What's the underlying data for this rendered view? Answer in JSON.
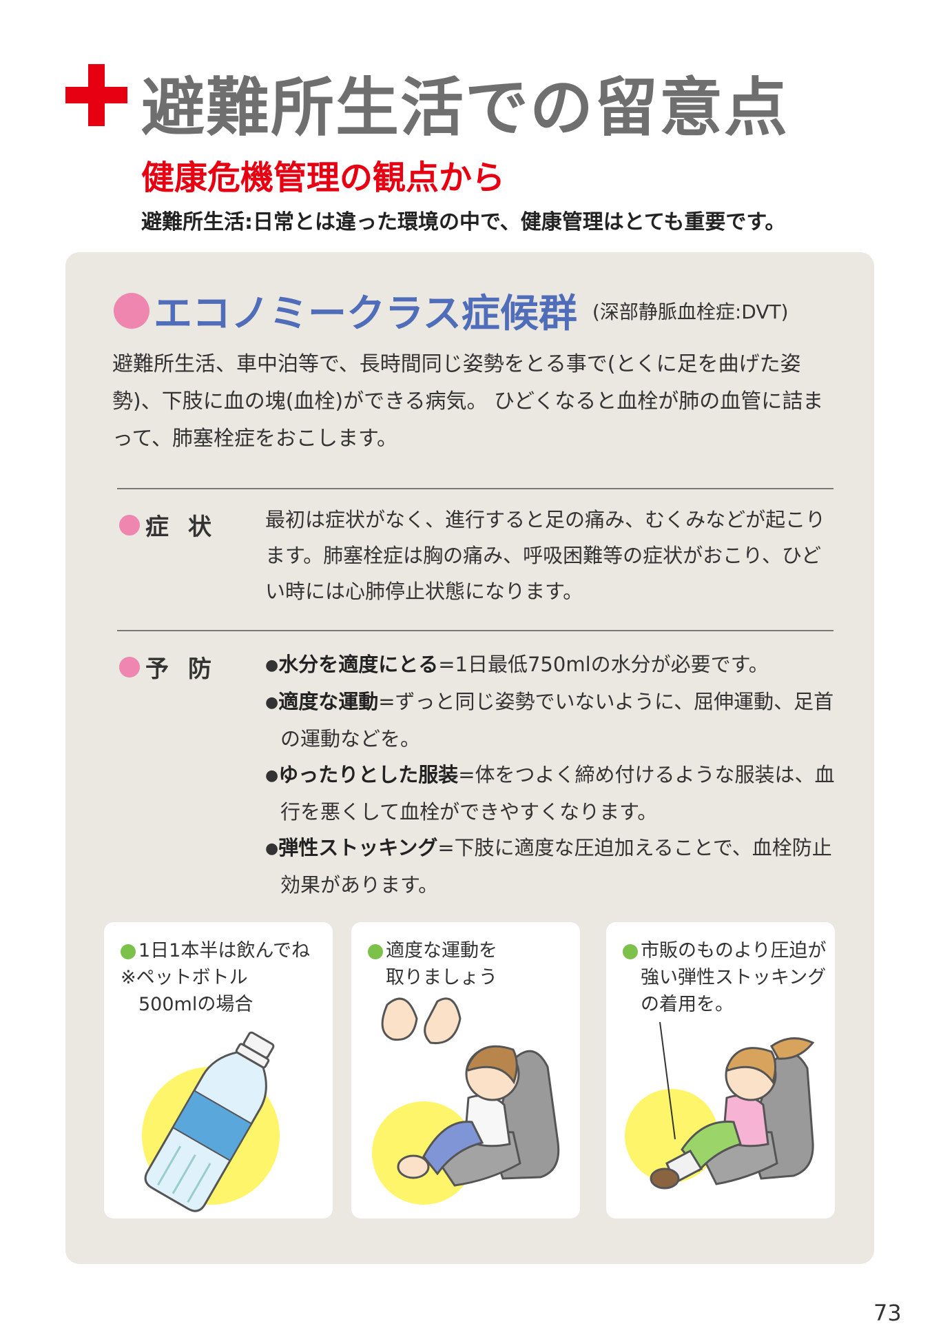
{
  "colors": {
    "accent_red": "#e60012",
    "title_gray": "#6f6f6f",
    "section_blue": "#4f6db8",
    "pink_bullet": "#ee86b0",
    "green_bullet": "#7bc14a",
    "panel_bg": "#ebe7e1",
    "illustration_yellow": "#fff56b"
  },
  "header": {
    "title": "避難所生活での留意点",
    "subtitle": "健康危機管理の観点から",
    "lead": "避難所生活:日常とは違った環境の中で、健康管理はとても重要です。"
  },
  "section": {
    "title": "エコノミークラス症候群",
    "subtitle": "(深部静脈血栓症:DVT)",
    "intro": "避難所生活、車中泊等で、長時間同じ姿勢をとる事で(とくに足を曲げた姿勢)、下肢に血の塊(血栓)ができる病気。 ひどくなると血栓が肺の血管に詰まって、肺塞栓症をおこします。"
  },
  "symptoms": {
    "label": "症状",
    "text": "最初は症状がなく、進行すると足の痛み、むくみなどが起こります。肺塞栓症は胸の痛み、呼吸困難等の症状がおこり、ひどい時には心肺停止状態になります。"
  },
  "prevention": {
    "label": "予防",
    "bullet": "●",
    "items": [
      {
        "term": "水分を適度にとる",
        "desc": "=1日最低750mlの水分が必要です。"
      },
      {
        "term": "適度な運動",
        "desc": "=ずっと同じ姿勢でいないように、屈伸運動、足首の運動などを。"
      },
      {
        "term": "ゆったりとした服装",
        "desc": "=体をつよく締め付けるような服装は、血行を悪くして血栓ができやすくなります。"
      },
      {
        "term": "弾性ストッキング",
        "desc": "=下肢に適度な圧迫加えることで、血栓防止効果があります。"
      }
    ]
  },
  "cards": [
    {
      "line1": "1日1本半は飲んでね",
      "line2": "※ペットボトル",
      "line3": "500mlの場合",
      "illustration": "water-bottle"
    },
    {
      "line1": "適度な運動を",
      "line2": "取りましょう",
      "line3": "",
      "illustration": "seated-person-exercising-feet"
    },
    {
      "line1": "市販のものより圧迫が",
      "line2": "強い弾性ストッキング",
      "line3": "の着用を。",
      "illustration": "seated-girl-wearing-stockings"
    }
  ],
  "page_number": "73"
}
